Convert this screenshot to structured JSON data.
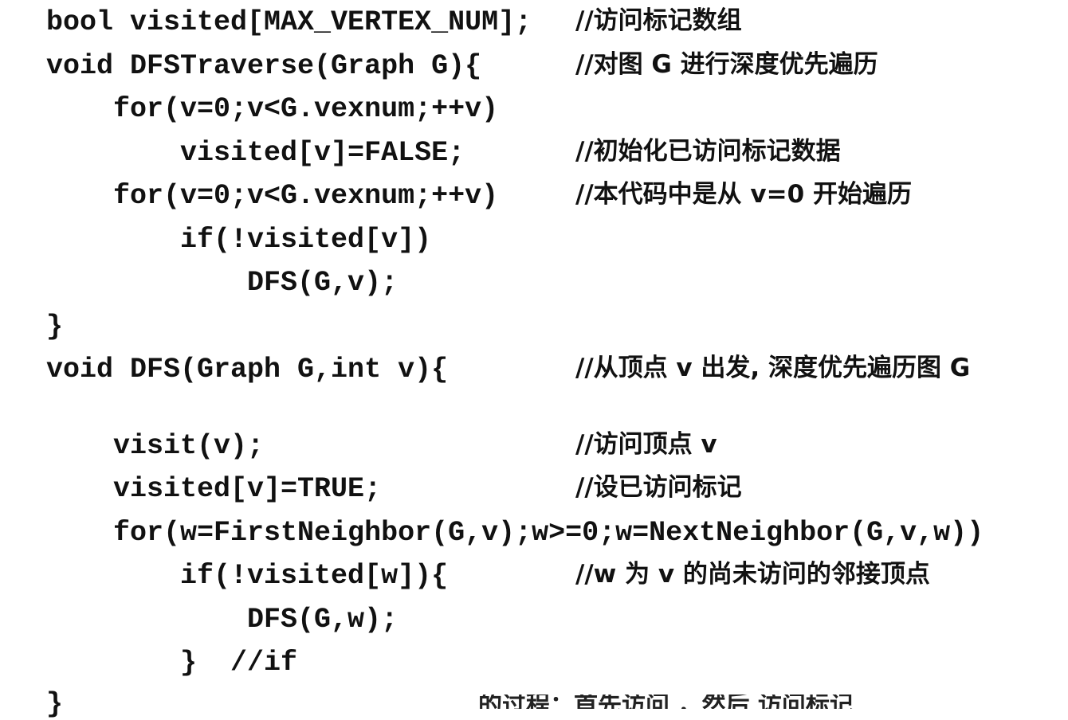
{
  "code": [
    {
      "code": "bool visited[MAX_VERTEX_NUM];",
      "comment": "//访问标记数组"
    },
    {
      "code": "void DFSTraverse(Graph G){",
      "comment": "//对图 G 进行深度优先遍历"
    },
    {
      "code": "    for(v=0;v<G.vexnum;++v)",
      "comment": ""
    },
    {
      "code": "        visited[v]=FALSE;",
      "comment": "//初始化已访问标记数据"
    },
    {
      "code": "    for(v=0;v<G.vexnum;++v)",
      "comment": "//本代码中是从 v=0 开始遍历"
    },
    {
      "code": "        if(!visited[v])",
      "comment": ""
    },
    {
      "code": "            DFS(G,v);",
      "comment": ""
    },
    {
      "code": "}",
      "comment": ""
    },
    {
      "code": "void DFS(Graph G,int v){",
      "comment": "//从顶点 v 出发, 深度优先遍历图 G"
    },
    {
      "code": "    visit(v);",
      "comment": "//访问顶点 v"
    },
    {
      "code": "    visited[v]=TRUE;",
      "comment": "//设已访问标记"
    },
    {
      "code": "    for(w=FirstNeighbor(G,v);w>=0;w=NextNeighbor(G,v,w))",
      "comment": ""
    },
    {
      "code": "        if(!visited[w]){",
      "comment": "//w 为 v 的尚未访问的邻接顶点"
    },
    {
      "code": "            DFS(G,w);",
      "comment": ""
    },
    {
      "code": "        }  //if",
      "comment": ""
    },
    {
      "code": "}",
      "comment": ""
    }
  ],
  "bottom_text": "的过程：首先访问 ，然后 访问标记"
}
